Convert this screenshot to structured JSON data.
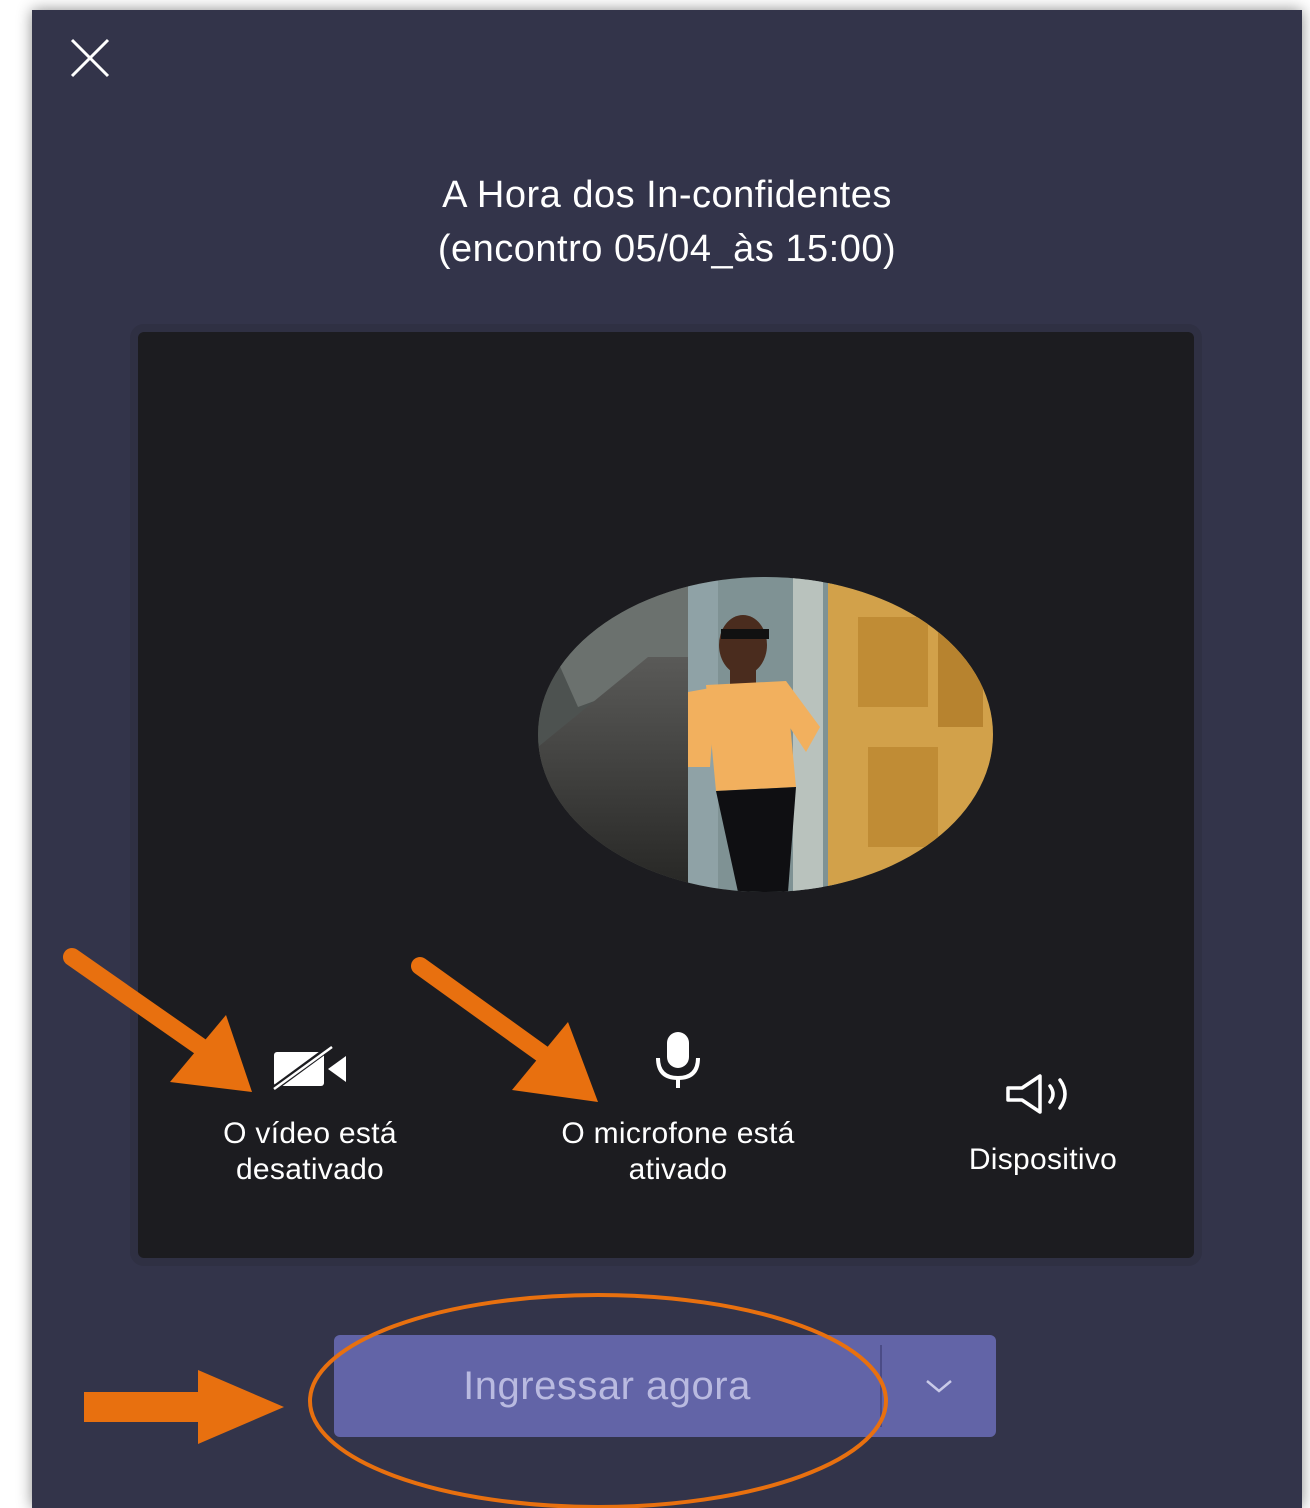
{
  "meeting": {
    "title_line1": "A Hora dos In-confidentes",
    "title_line2": "(encontro 05/04_às 15:00)"
  },
  "close_icon": "close-icon",
  "controls": {
    "video": {
      "label_line1": "O vídeo está",
      "label_line2": "desativado",
      "icon": "video-off-icon",
      "state": "off"
    },
    "mic": {
      "label_line1": "O microfone está",
      "label_line2": "ativado",
      "icon": "microphone-icon",
      "state": "on"
    },
    "device": {
      "label": "Dispositivo",
      "icon": "speaker-icon"
    }
  },
  "join": {
    "label": "Ingressar agora",
    "chevron_icon": "chevron-down-icon"
  },
  "colors": {
    "background": "#33344a",
    "preview": "#1c1c20",
    "join_button": "#6264a7",
    "annotation": "#e8700f"
  }
}
